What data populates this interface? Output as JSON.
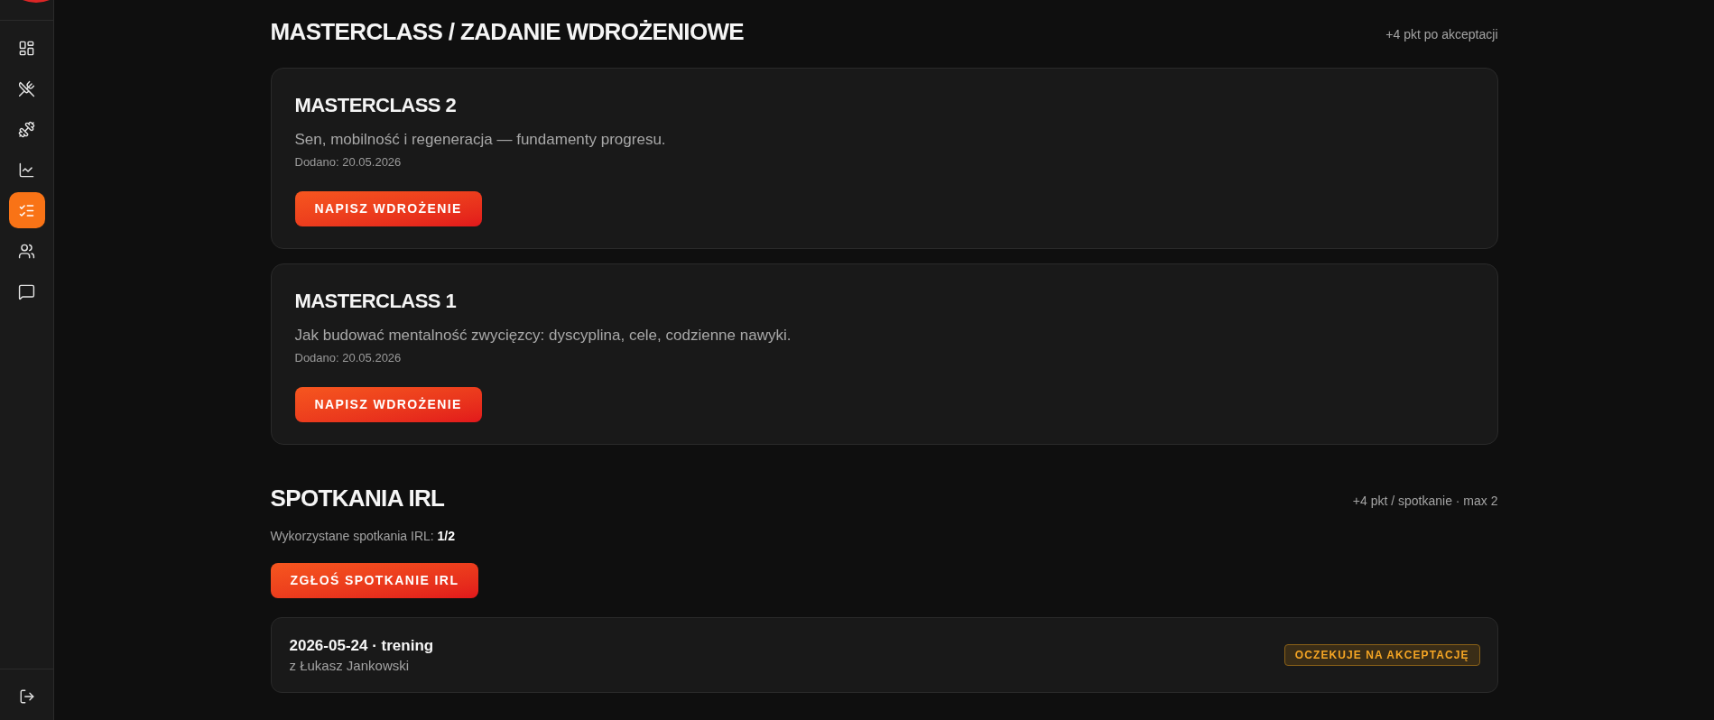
{
  "sidebar": {
    "nav_items": [
      {
        "selected": false
      },
      {
        "selected": false
      },
      {
        "selected": false
      },
      {
        "selected": false
      },
      {
        "selected": true
      },
      {
        "selected": false
      },
      {
        "selected": false
      }
    ]
  },
  "masterclass": {
    "title": "MASTERCLASS / ZADANIE WDROŻENIOWE",
    "points_note": "+4 pkt po akceptacji",
    "cards": [
      {
        "title": "MASTERCLASS 2",
        "description": "Sen, mobilność i regeneracja — fundamenty progresu.",
        "added": "Dodano: 20.05.2026",
        "button": "NAPISZ WDROŻENIE"
      },
      {
        "title": "MASTERCLASS 1",
        "description": "Jak budować mentalność zwycięzcy: dyscyplina, cele, codzienne nawyki.",
        "added": "Dodano: 20.05.2026",
        "button": "NAPISZ WDROŻENIE"
      }
    ]
  },
  "irl_meetings": {
    "title": "SPOTKANIA IRL",
    "points_note": "+4 pkt / spotkanie · max 2",
    "usage": "Wykorzystane spotkania IRL: **1/2**",
    "button": "ZGŁOŚ SPOTKANIE IRL",
    "entries": [
      {
        "title": "2026-05-24 · trening",
        "with": "z Łukasz Jankowski",
        "status": "OCZEKUJE NA AKCEPTACJĘ"
      }
    ]
  }
}
